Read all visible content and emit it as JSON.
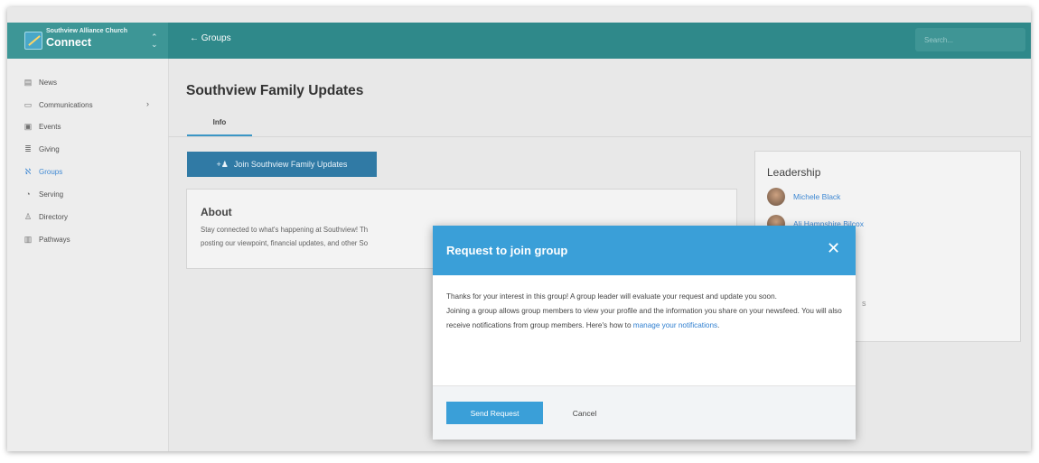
{
  "app": {
    "church_name": "Southview Alliance Church",
    "app_name": "Connect",
    "switch_icon": "chevron-up-down-icon"
  },
  "topbar": {
    "back_label": "← Groups",
    "search_placeholder": "Search..."
  },
  "sidebar": {
    "items": [
      {
        "label": "News",
        "icon": "news-icon",
        "glyph": "▤"
      },
      {
        "label": "Communications",
        "icon": "chat-icon",
        "glyph": "▭",
        "has_submenu": true
      },
      {
        "label": "Events",
        "icon": "calendar-icon",
        "glyph": "▣"
      },
      {
        "label": "Giving",
        "icon": "gift-icon",
        "glyph": "≣"
      },
      {
        "label": "Groups",
        "icon": "groups-icon",
        "glyph": "ℵ",
        "active": true
      },
      {
        "label": "Serving",
        "icon": "hand-icon",
        "glyph": "◔"
      },
      {
        "label": "Directory",
        "icon": "directory-icon",
        "glyph": "♙"
      },
      {
        "label": "Pathways",
        "icon": "pathways-icon",
        "glyph": "▥"
      }
    ],
    "submenu_chevron": "›"
  },
  "group": {
    "title": "Southview Family Updates",
    "tabs": [
      {
        "label": "Info"
      }
    ],
    "join_button_label": "Join Southview Family Updates",
    "about_title": "About",
    "about_text_line1": "Stay connected to what's happening at Southview! Th",
    "about_text_line2": "posting our viewpoint, financial updates, and other So"
  },
  "leadership": {
    "title": "Leadership",
    "leaders": [
      {
        "name": "Michele Black"
      },
      {
        "name": "Ali Hampshire Bilcox"
      }
    ],
    "obscured_char": "s"
  },
  "modal": {
    "title": "Request to join group",
    "close_glyph": "✕",
    "paragraph1": "Thanks for your interest in this group! A group leader will evaluate your request and update you soon.",
    "paragraph2": "Joining a group allows group members to view your profile and the information you share on your newsfeed. You will also receive notifications from group members. Here's how to",
    "link_text": "manage your notifications",
    "link_suffix": ".",
    "send_label": "Send Request",
    "cancel_label": "Cancel"
  },
  "colors": {
    "topbar": "#1e7f80",
    "accent": "#3a9fd8",
    "join_button": "#1f6f9e",
    "link": "#2f7fd0"
  }
}
